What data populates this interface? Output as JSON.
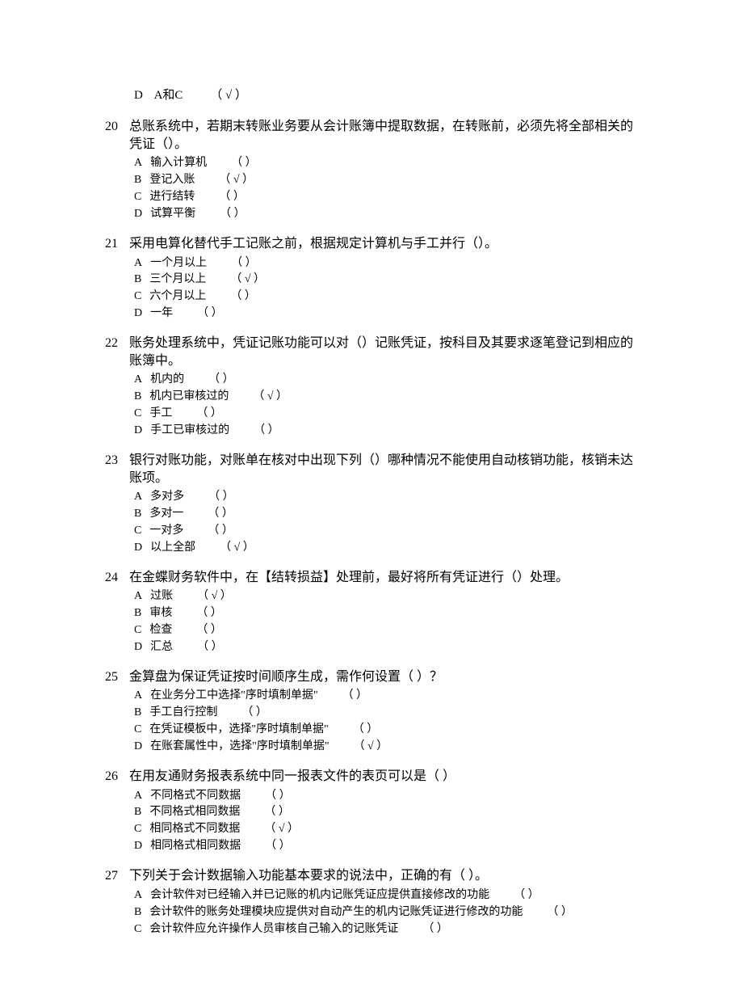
{
  "marks": {
    "blank": "（     ）",
    "correct": "（  √  ）"
  },
  "top_option": {
    "letter": "D",
    "text": "A和C",
    "correct": true
  },
  "questions": [
    {
      "num": "20",
      "stem": "总账系统中，若期末转账业务要从会计账簿中提取数据，在转账前，必须先将全部相关的凭证（）。",
      "options": [
        {
          "letter": "A",
          "text": "输入计算机",
          "correct": false
        },
        {
          "letter": "B",
          "text": "登记入账",
          "correct": true
        },
        {
          "letter": "C",
          "text": "进行结转",
          "correct": false
        },
        {
          "letter": "D",
          "text": "试算平衡",
          "correct": false
        }
      ]
    },
    {
      "num": "21",
      "stem": "采用电算化替代手工记账之前，根据规定计算机与手工并行（）。",
      "options": [
        {
          "letter": "A",
          "text": "一个月以上",
          "correct": false
        },
        {
          "letter": "B",
          "text": "三个月以上",
          "correct": true
        },
        {
          "letter": "C",
          "text": "六个月以上",
          "correct": false
        },
        {
          "letter": "D",
          "text": "一年",
          "correct": false
        }
      ]
    },
    {
      "num": "22",
      "stem": "账务处理系统中，凭证记账功能可以对（）记账凭证，按科目及其要求逐笔登记到相应的账簿中。",
      "options": [
        {
          "letter": "A",
          "text": "机内的",
          "correct": false
        },
        {
          "letter": "B",
          "text": "机内已审核过的",
          "correct": true
        },
        {
          "letter": "C",
          "text": "手工",
          "correct": false
        },
        {
          "letter": "D",
          "text": "手工已审核过的",
          "correct": false
        }
      ]
    },
    {
      "num": "23",
      "stem": "银行对账功能，对账单在核对中出现下列（）哪种情况不能使用自动核销功能，核销未达账项。",
      "options": [
        {
          "letter": "A",
          "text": "多对多",
          "correct": false
        },
        {
          "letter": "B",
          "text": "多对一",
          "correct": false
        },
        {
          "letter": "C",
          "text": "一对多",
          "correct": false
        },
        {
          "letter": "D",
          "text": "以上全部",
          "correct": true
        }
      ]
    },
    {
      "num": "24",
      "stem": "在金蝶财务软件中，在【结转损益】处理前，最好将所有凭证进行（）处理。",
      "options": [
        {
          "letter": "A",
          "text": "过账",
          "correct": true
        },
        {
          "letter": "B",
          "text": "审核",
          "correct": false
        },
        {
          "letter": "C",
          "text": "检查",
          "correct": false
        },
        {
          "letter": "D",
          "text": "汇总",
          "correct": false
        }
      ]
    },
    {
      "num": "25",
      "stem": "金算盘为保证凭证按时间顺序生成，需作何设置（  ）？",
      "options": [
        {
          "letter": "A",
          "text": "在业务分工中选择\"序时填制单据\"",
          "correct": false
        },
        {
          "letter": "B",
          "text": "手工自行控制",
          "correct": false
        },
        {
          "letter": "C",
          "text": "在凭证模板中，选择\"序时填制单据\"",
          "correct": false
        },
        {
          "letter": "D",
          "text": "在账套属性中，选择\"序时填制单据\"",
          "correct": true
        }
      ]
    },
    {
      "num": "26",
      "stem": "在用友通财务报表系统中同一报表文件的表页可以是（       ）",
      "options": [
        {
          "letter": "A",
          "text": "不同格式不同数据",
          "correct": false
        },
        {
          "letter": "B",
          "text": "不同格式相同数据",
          "correct": false
        },
        {
          "letter": "C",
          "text": "相同格式不同数据",
          "correct": true
        },
        {
          "letter": "D",
          "text": "相同格式相同数据",
          "correct": false
        }
      ]
    },
    {
      "num": "27",
      "stem": "下列关于会计数据输入功能基本要求的说法中，正确的有（    ）。",
      "options": [
        {
          "letter": "A",
          "text": "会计软件对已经输入并已记账的机内记账凭证应提供直接修改的功能",
          "correct": false
        },
        {
          "letter": "B",
          "text": "会计软件的账务处理模块应提供对自动产生的机内记账凭证进行修改的功能",
          "correct": false
        },
        {
          "letter": "C",
          "text": "会计软件应允许操作人员审核自己输入的记账凭证",
          "correct": false
        }
      ]
    }
  ]
}
